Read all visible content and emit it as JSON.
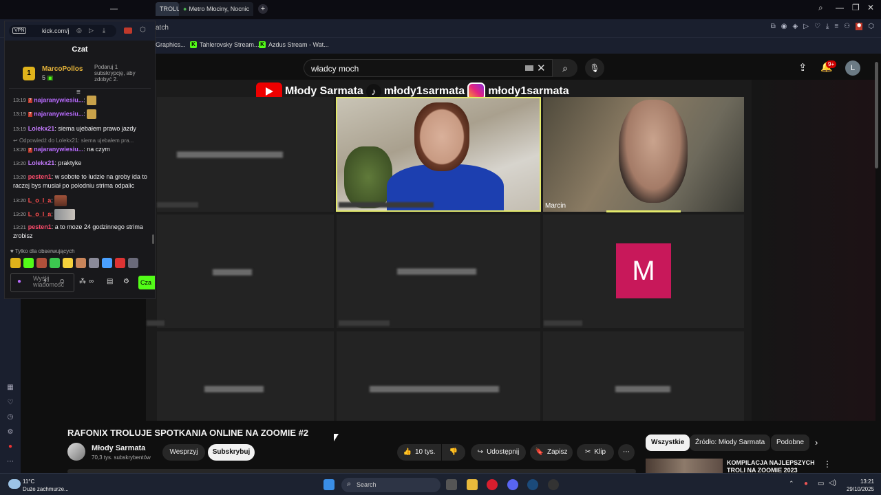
{
  "browser": {
    "tab_partial": "TROLU",
    "tab_maps": "Metro Młociny, Nocnicki",
    "address_partial": "atch",
    "bookmarks": [
      "Graphics...",
      "Tahlerovsky Stream...",
      "Azdus Stream - Wat..."
    ]
  },
  "youtube": {
    "search_value": "władcy moch",
    "notifications_badge": "9+",
    "avatar_letter": "L"
  },
  "video": {
    "banner_items": [
      "Młody Sarmata",
      "młody1sarmata",
      "młody1sarmata"
    ],
    "participant_name": "Marcin",
    "avatar_letter": "M",
    "title": "RAFONIX TROLUJE SPOTKANIA ONLINE NA ZOOMIE #2",
    "channel_name": "Młody Sarmata",
    "channel_subs": "70,3 tys. subskrybentów",
    "btn_support": "Wesprzyj",
    "btn_subscribe": "Subskrybuj",
    "likes": "10 tys.",
    "btn_share": "Udostępnij",
    "btn_save": "Zapisz",
    "btn_clip": "Klip"
  },
  "recommendations": {
    "chips": [
      "Wszystkie",
      "Źródło: Młody Sarmata",
      "Podobne"
    ],
    "first_title": "KOMPILACJA NAJLEPSZYCH TROLI NA ZOOMIE 2023"
  },
  "chat": {
    "address": "kick.com/j",
    "vpn": "VPN",
    "header": "Czat",
    "pinned_rank": "1",
    "pinned_user": "MarcoPollos",
    "pinned_count": "5",
    "pinned_hint": "Podaruj 1 subskrypcję, aby zdobyć 2.",
    "messages": [
      {
        "time": "13:19",
        "user": "najaranywiesiu...",
        "text": ":"
      },
      {
        "time": "13:19",
        "user": "najaranywiesiu...",
        "text": ":"
      },
      {
        "time": "13:19",
        "user": "Lolekx21",
        "text": ": siema ujebałem prawo jazdy"
      },
      {
        "time": "13:20",
        "user": "najaranywiesiu...",
        "text": ": na czym",
        "reply": "Odpowiedź do Lolekx21: siema ujebałem pra..."
      },
      {
        "time": "13:20",
        "user": "Lolekx21",
        "text": ": praktyke"
      },
      {
        "time": "13:20",
        "user": "pesten1",
        "text": ": w sobote to ludzie na groby ida to raczej bys musiał po polodniu strima odpalic"
      },
      {
        "time": "13:20",
        "user": "L_o_l_a",
        "text": ":"
      },
      {
        "time": "13:20",
        "user": "L_o_l_a",
        "text": ":"
      },
      {
        "time": "13:21",
        "user": "pesten1",
        "text": ": a to moze 24 godzinnego strima zrobisz"
      }
    ],
    "followers_only": "Tylko dla obserwujących",
    "input_placeholder": "Wyślij wiadomość",
    "send_label": "Cza"
  },
  "taskbar": {
    "temperature": "11°C",
    "weather": "Duże zachmurze...",
    "search_placeholder": "Search",
    "time": "13:21",
    "date": "29/10/2025"
  },
  "colors": {
    "kick_green": "#53fc18",
    "yt_red": "#ff0000",
    "zoom_highlight": "#e3e96b",
    "avatar_m": "#c8185a"
  }
}
